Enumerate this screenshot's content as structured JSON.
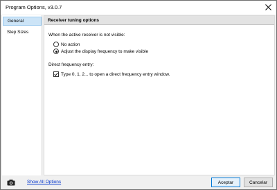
{
  "window": {
    "title": "Program Options, v3.0.7"
  },
  "sidebar": {
    "items": [
      {
        "label": "General"
      },
      {
        "label": "Step Sizes"
      }
    ]
  },
  "main": {
    "section_header": "Receiver tuning options",
    "not_visible_label": "When the active receiver is not visible:",
    "options": [
      {
        "label": "No action",
        "checked": false
      },
      {
        "label": "Adjust the display frequency to make visible",
        "checked": true
      }
    ],
    "direct_entry_label": "Direct frequency entry:",
    "direct_entry_checkbox": {
      "label": "Type 0, 1, 2... to open a direct frequency entry window.",
      "checked": true
    }
  },
  "footer": {
    "show_all_link": "Show All Options",
    "accept_label": "Aceptar",
    "cancel_label": "Cancelar"
  },
  "icons": {
    "close": "close-icon",
    "camera": "camera-icon"
  },
  "colors": {
    "accent": "#0078d7",
    "selection": "#cce4f7",
    "link": "#0033cc"
  }
}
